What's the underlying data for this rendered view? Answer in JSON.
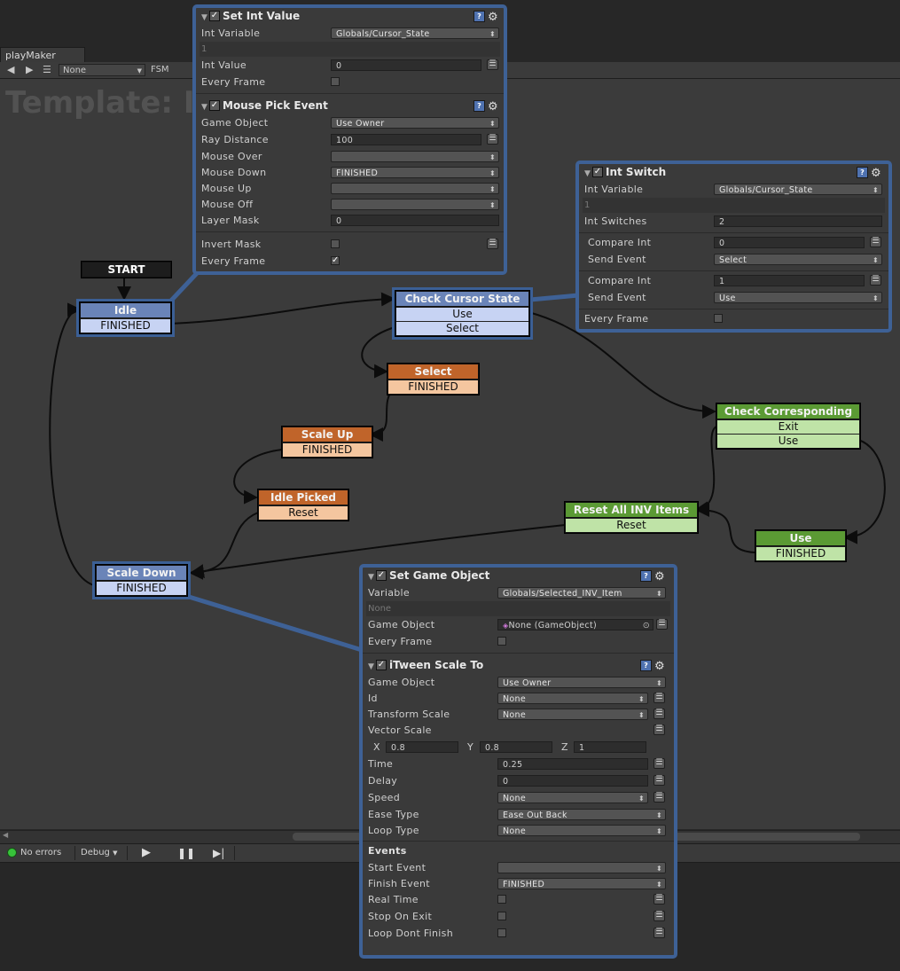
{
  "window": {
    "tab_title": "playMaker",
    "dropdown_value": "None",
    "fsm_label": "FSM",
    "template_title": "Template: I"
  },
  "statusbar": {
    "errors_label": "No errors",
    "debug_label": "Debug"
  },
  "states": {
    "start": {
      "title": "START"
    },
    "idle": {
      "title": "Idle",
      "events": [
        "FINISHED"
      ]
    },
    "check_cursor": {
      "title": "Check Cursor State",
      "events": [
        "Use",
        "Select"
      ]
    },
    "select": {
      "title": "Select",
      "events": [
        "FINISHED"
      ]
    },
    "scale_up": {
      "title": "Scale Up",
      "events": [
        "FINISHED"
      ]
    },
    "idle_picked": {
      "title": "Idle Picked",
      "events": [
        "Reset"
      ]
    },
    "check_corresponding": {
      "title": "Check Corresponding",
      "events": [
        "Exit",
        "Use"
      ]
    },
    "reset_all": {
      "title": "Reset All INV Items",
      "events": [
        "Reset"
      ]
    },
    "use": {
      "title": "Use",
      "events": [
        "FINISHED"
      ]
    },
    "scale_down": {
      "title": "Scale Down",
      "events": [
        "FINISHED"
      ]
    }
  },
  "panel_idle": {
    "set_int": {
      "title": "Set Int Value",
      "int_variable_label": "Int Variable",
      "int_variable_value": "Globals/Cursor_State",
      "sub_value": "1",
      "int_value_label": "Int Value",
      "int_value_value": "0",
      "every_frame_label": "Every Frame"
    },
    "mouse_pick": {
      "title": "Mouse Pick Event",
      "game_object_label": "Game Object",
      "game_object_value": "Use Owner",
      "ray_distance_label": "Ray Distance",
      "ray_distance_value": "100",
      "mouse_over_label": "Mouse Over",
      "mouse_over_value": "",
      "mouse_down_label": "Mouse Down",
      "mouse_down_value": "FINISHED",
      "mouse_up_label": "Mouse Up",
      "mouse_up_value": "",
      "mouse_off_label": "Mouse Off",
      "mouse_off_value": "",
      "layer_mask_label": "Layer Mask",
      "layer_mask_value": "0",
      "invert_mask_label": "Invert Mask",
      "every_frame_label": "Every Frame",
      "every_frame_checked": true
    }
  },
  "panel_switch": {
    "title": "Int Switch",
    "int_variable_label": "Int Variable",
    "int_variable_value": "Globals/Cursor_State",
    "sub_value": "1",
    "int_switches_label": "Int Switches",
    "int_switches_value": "2",
    "compare1_label": "Compare Int",
    "compare1_value": "0",
    "send1_label": "Send Event",
    "send1_value": "Select",
    "compare2_label": "Compare Int",
    "compare2_value": "1",
    "send2_label": "Send Event",
    "send2_value": "Use",
    "every_frame_label": "Every Frame"
  },
  "panel_scale_down": {
    "set_go": {
      "title": "Set Game Object",
      "variable_label": "Variable",
      "variable_value": "Globals/Selected_INV_Item",
      "sub_value": "None",
      "game_object_label": "Game Object",
      "game_object_value": "None (GameObject)",
      "every_frame_label": "Every Frame"
    },
    "itween": {
      "title": "iTween Scale To",
      "game_object_label": "Game Object",
      "game_object_value": "Use Owner",
      "id_label": "Id",
      "id_value": "None",
      "transform_scale_label": "Transform Scale",
      "transform_scale_value": "None",
      "vector_scale_label": "Vector Scale",
      "x_label": "X",
      "x_value": "0.8",
      "y_label": "Y",
      "y_value": "0.8",
      "z_label": "Z",
      "z_value": "1",
      "time_label": "Time",
      "time_value": "0.25",
      "delay_label": "Delay",
      "delay_value": "0",
      "speed_label": "Speed",
      "speed_value": "None",
      "ease_type_label": "Ease Type",
      "ease_type_value": "Ease Out Back",
      "loop_type_label": "Loop Type",
      "loop_type_value": "None",
      "events_label": "Events",
      "start_event_label": "Start Event",
      "start_event_value": "",
      "finish_event_label": "Finish Event",
      "finish_event_value": "FINISHED",
      "real_time_label": "Real Time",
      "stop_on_exit_label": "Stop On Exit",
      "loop_dont_finish_label": "Loop Dont Finish"
    }
  },
  "colors": {
    "selection": "#3e6196",
    "state_blue": "#6a84b8",
    "state_orange": "#c0642a",
    "state_green": "#5b9a34"
  }
}
